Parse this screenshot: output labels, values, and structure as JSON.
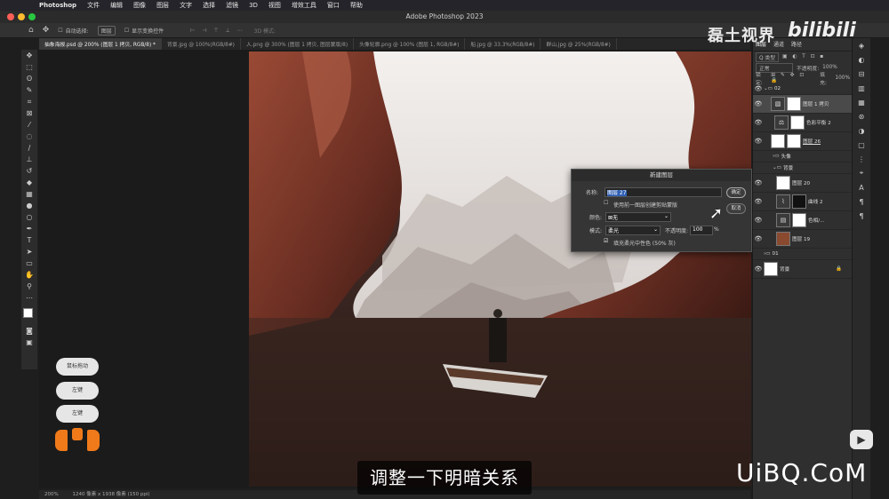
{
  "menubar": {
    "app_name": "Photoshop",
    "items": [
      "文件",
      "编辑",
      "图像",
      "图层",
      "文字",
      "选择",
      "滤镜",
      "3D",
      "视图",
      "增效工具",
      "窗口",
      "帮助"
    ]
  },
  "window": {
    "title": "Adobe Photoshop 2023"
  },
  "options": {
    "auto_select_label": "自动选择:",
    "auto_select_value": "图层",
    "show_transform_label": "显示变换控件",
    "mode_3d": "3D 模式:"
  },
  "tabs": [
    "抽象海报.psd @ 200% (图层 1 拷贝, RGB/8) *",
    "背景.jpg @ 100%(RGB/8#)",
    "人.png @ 300% (图层 1 拷贝, 图层蒙版/8)",
    "头像轮廓.png @ 100% (图层 1, RGB/8#)",
    "船.jpg @ 33.3%(RGB/8#)",
    "群山.jpg @ 25%(RGB/8#)"
  ],
  "status": {
    "zoom": "200%",
    "doc_info": "1240 像素 x 1938 像素 (150 ppi)"
  },
  "dialog": {
    "title": "新建图层",
    "name_label": "名称:",
    "name_value": "图层 27",
    "clip_label": "使用前一图层创建剪贴蒙版",
    "color_label": "颜色:",
    "color_value": "无",
    "mode_label": "模式:",
    "mode_value": "柔光",
    "opacity_label": "不透明度:",
    "opacity_value": "100",
    "opacity_unit": "%",
    "fill_label": "填充柔光中性色 (50% 灰)",
    "ok": "确定",
    "cancel": "取消"
  },
  "layers_panel": {
    "tabs": [
      "图层",
      "通道",
      "路径"
    ],
    "filter": "Q 类型",
    "blend": "正常",
    "opacity_label": "不透明度:",
    "opacity": "100%",
    "lock_label": "锁定:",
    "fill_label": "填充:",
    "fill": "100%",
    "layers": [
      {
        "name": "02",
        "kind": "group"
      },
      {
        "name": "图层 1 拷贝",
        "kind": "layer",
        "selected": true
      },
      {
        "name": "色彩平衡 2",
        "kind": "adjust"
      },
      {
        "name": "图层 26",
        "kind": "layer"
      },
      {
        "name": "头像",
        "kind": "group"
      },
      {
        "name": "背景",
        "kind": "group"
      },
      {
        "name": "图层 20",
        "kind": "layer"
      },
      {
        "name": "曲线 2",
        "kind": "adjust"
      },
      {
        "name": "色相/...",
        "kind": "adjust"
      },
      {
        "name": "图层 19",
        "kind": "dark"
      },
      {
        "name": "01",
        "kind": "group"
      },
      {
        "name": "背景",
        "kind": "background"
      }
    ]
  },
  "overlay": {
    "keys": [
      "鼠标拖动",
      "左键",
      "左键"
    ]
  },
  "subtitle": "调整一下明暗关系",
  "watermarks": {
    "channel": "磊土视界",
    "site": "UiBQ.CoM",
    "bili": "bilibili"
  }
}
